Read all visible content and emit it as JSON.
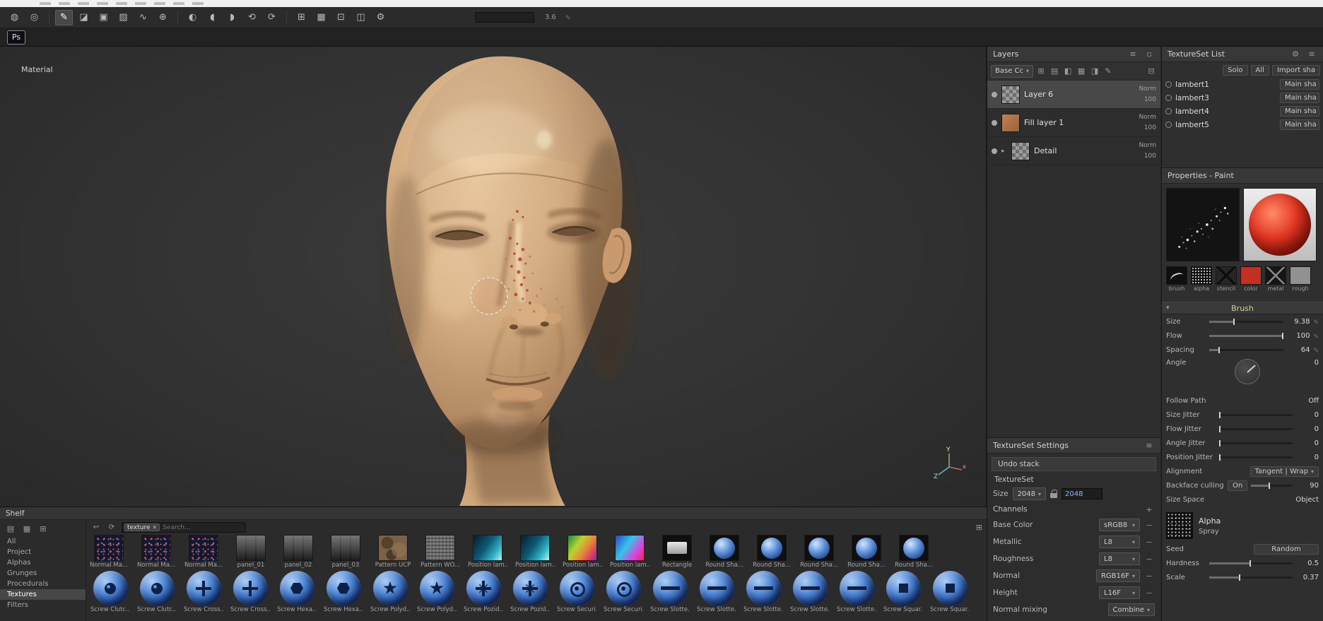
{
  "colors": {
    "accent_material_red": "#d23a24",
    "screw_blue": "#3e77c9",
    "skin_tone": "#d4ad82",
    "panel_bg": "#2d2d2d"
  },
  "ps_badge": "Ps",
  "toolbar": {
    "tools": [
      {
        "glyph": "◍"
      },
      {
        "glyph": "◎"
      },
      {
        "glyph": "✎"
      },
      {
        "glyph": "◪"
      },
      {
        "glyph": "▣"
      },
      {
        "glyph": "▧"
      },
      {
        "glyph": "∿"
      },
      {
        "glyph": "⊕"
      },
      {
        "glyph": "◐"
      },
      {
        "glyph": "◖"
      },
      {
        "glyph": "◗"
      },
      {
        "glyph": "⟲"
      },
      {
        "glyph": "⟳"
      },
      {
        "glyph": "⊞"
      },
      {
        "glyph": "▦"
      },
      {
        "glyph": "⊡"
      },
      {
        "glyph": "◫"
      },
      {
        "glyph": "⚙"
      }
    ],
    "value": "3.6"
  },
  "viewport": {
    "material_label": "Material",
    "axis": {
      "y": "Y",
      "z": "Z",
      "x": "x"
    }
  },
  "layers_panel": {
    "title": "Layers",
    "blend_mode": "Base Cc",
    "layers": [
      {
        "name": "Layer 6",
        "blend": "Norm",
        "opacity": "100",
        "kind": "paint",
        "state": "selected"
      },
      {
        "name": "Fill layer 1",
        "blend": "Norm",
        "opacity": "100",
        "kind": "fill",
        "state": ""
      },
      {
        "name": "Detail",
        "blend": "Norm",
        "opacity": "100",
        "kind": "group",
        "state": ""
      }
    ]
  },
  "textureset_settings": {
    "title": "TextureSet Settings",
    "undo_stack": "Undo stack",
    "textureset": "TextureSet",
    "size_label": "Size",
    "size_value": "2048",
    "size_field": "2048",
    "channels_label": "Channels",
    "channels": [
      {
        "name": "Base Color",
        "format": "sRGB8"
      },
      {
        "name": "Metallic",
        "format": "L8"
      },
      {
        "name": "Roughness",
        "format": "L8"
      },
      {
        "name": "Normal",
        "format": "RGB16F"
      },
      {
        "name": "Height",
        "format": "L16F"
      }
    ],
    "normal_mixing_label": "Normal mixing",
    "normal_mixing_value": "Combine"
  },
  "textureset_list": {
    "title": "TextureSet List",
    "solo": "Solo",
    "all": "All",
    "import": "Import sha",
    "items": [
      {
        "name": "lambert1",
        "shader": "Main sha"
      },
      {
        "name": "lambert3",
        "shader": "Main sha"
      },
      {
        "name": "lambert4",
        "shader": "Main sha"
      },
      {
        "name": "lambert5",
        "shader": "Main sha"
      }
    ]
  },
  "properties": {
    "title": "Properties - Paint",
    "thumbs": [
      {
        "label": "brush",
        "kind": "t-brush"
      },
      {
        "label": "alpha",
        "kind": "t-alpha"
      },
      {
        "label": "stencil",
        "kind": "t-stencil"
      },
      {
        "label": "color",
        "kind": "t-color"
      },
      {
        "label": "metal",
        "kind": "t-metal"
      },
      {
        "label": "rough",
        "kind": "t-rough"
      }
    ],
    "brush_section": "Brush",
    "params": [
      {
        "label": "Size",
        "value": "9.38",
        "fill": 34
      },
      {
        "label": "Flow",
        "value": "100",
        "fill": 100
      },
      {
        "label": "Spacing",
        "value": "64",
        "fill": 14
      }
    ],
    "angle_label": "Angle",
    "angle_value": "0",
    "follow_path_label": "Follow Path",
    "follow_path_value": "Off",
    "jitters": [
      {
        "label": "Size Jitter",
        "value": "0",
        "fill": 0
      },
      {
        "label": "Flow Jitter",
        "value": "0",
        "fill": 0
      },
      {
        "label": "Angle Jitter",
        "value": "0",
        "fill": 0
      },
      {
        "label": "Position Jitter",
        "value": "0",
        "fill": 0
      }
    ],
    "alignment_label": "Alignment",
    "alignment_value": "Tangent | Wrap",
    "backface_label": "Backface culling",
    "backface_value": "On",
    "backface_number": "90",
    "size_space_label": "Size Space",
    "size_space_value": "Object",
    "alpha_section": "Alpha",
    "alpha_name": "Spray",
    "seed_label": "Seed",
    "seed_value": "Random",
    "hardness_label": "Hardness",
    "hardness_value": "0.5",
    "hardness_fill": 50,
    "scale_label": "Scale",
    "scale_value": "0.37",
    "scale_fill": 37
  },
  "shelf": {
    "title": "Shelf",
    "search": {
      "tag": "texture",
      "placeholder": "Search..."
    },
    "categories": [
      {
        "label": "All",
        "state": ""
      },
      {
        "label": "Project",
        "state": ""
      },
      {
        "label": "Alphas",
        "state": ""
      },
      {
        "label": "Grunges",
        "state": ""
      },
      {
        "label": "Procedurals",
        "state": ""
      },
      {
        "label": "Textures",
        "state": "selected"
      },
      {
        "label": "Filters",
        "state": ""
      }
    ],
    "row1": [
      {
        "label": "Normal Ma...",
        "kind": "k-normal"
      },
      {
        "label": "Normal Ma...",
        "kind": "k-normal"
      },
      {
        "label": "Normal Ma...",
        "kind": "k-normal"
      },
      {
        "label": "panel_01",
        "kind": "k-panel"
      },
      {
        "label": "panel_02",
        "kind": "k-panel"
      },
      {
        "label": "panel_03",
        "kind": "k-panel"
      },
      {
        "label": "Pattern UCP",
        "kind": "k-ucp"
      },
      {
        "label": "Pattern WO...",
        "kind": "k-wo"
      },
      {
        "label": "Position lam...",
        "kind": "k-pos1"
      },
      {
        "label": "Position lam...",
        "kind": "k-pos1"
      },
      {
        "label": "Position lam...",
        "kind": "k-pos2"
      },
      {
        "label": "Position lam...",
        "kind": "k-pos3"
      },
      {
        "label": "Rectangle",
        "kind": "k-rect"
      },
      {
        "label": "Round Sha...",
        "kind": "k-round"
      },
      {
        "label": "Round Sha...",
        "kind": "k-round"
      },
      {
        "label": "Round Sha...",
        "kind": "k-round"
      },
      {
        "label": "Round Sha...",
        "kind": "k-round"
      },
      {
        "label": "Round Sha...",
        "kind": "k-round"
      }
    ],
    "row2": [
      {
        "label": "Screw Clutc...",
        "kind": "d-clutch"
      },
      {
        "label": "Screw Clutc...",
        "kind": "d-clutch"
      },
      {
        "label": "Screw Cross...",
        "kind": "d-cross"
      },
      {
        "label": "Screw Cross...",
        "kind": "d-cross"
      },
      {
        "label": "Screw Hexa...",
        "kind": "d-hexa"
      },
      {
        "label": "Screw Hexa...",
        "kind": "d-hexa"
      },
      {
        "label": "Screw Polyd...",
        "kind": "d-polyd"
      },
      {
        "label": "Screw Polyd...",
        "kind": "d-polyd"
      },
      {
        "label": "Screw Pozid...",
        "kind": "d-pozid"
      },
      {
        "label": "Screw Pozid...",
        "kind": "d-pozid"
      },
      {
        "label": "Screw Securi...",
        "kind": "d-securi"
      },
      {
        "label": "Screw Securi...",
        "kind": "d-securi"
      },
      {
        "label": "Screw Slotte...",
        "kind": "d-slotte"
      },
      {
        "label": "Screw Slotte...",
        "kind": "d-slotte"
      },
      {
        "label": "Screw Slotte...",
        "kind": "d-slotte"
      },
      {
        "label": "Screw Slotte...",
        "kind": "d-slotte"
      },
      {
        "label": "Screw Slotte...",
        "kind": "d-slotte"
      },
      {
        "label": "Screw Squar...",
        "kind": "d-squar"
      },
      {
        "label": "Screw Squar...",
        "kind": "d-squar"
      }
    ]
  }
}
